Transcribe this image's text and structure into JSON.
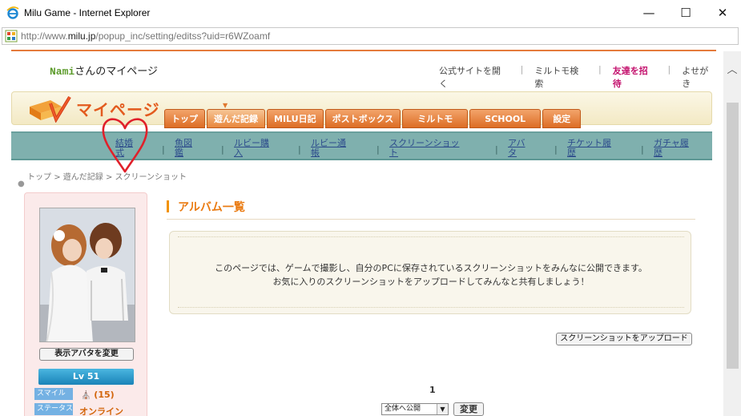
{
  "window": {
    "title": "Milu Game - Internet Explorer",
    "minimize": "—",
    "maximize": "☐",
    "close": "✕"
  },
  "address": {
    "prefix": "http://www.",
    "host": "milu.jp",
    "path": "/popup_inc/setting/editss?uid=r6WZoamf"
  },
  "header": {
    "user_name": "Nami",
    "user_suffix": "さんのマイページ",
    "links": [
      "公式サイトを開く",
      "ミルトモ検索",
      "友達を招待",
      "よせがき"
    ]
  },
  "banner": {
    "title": "マイページ",
    "tabs": [
      "トップ",
      "遊んだ記録",
      "MILU日記",
      "ポストボックス",
      "ミルトモ",
      "SCHOOL",
      "設定"
    ],
    "active_tab": "遊んだ記録"
  },
  "subnav": {
    "items": [
      {
        "line1": "結婚",
        "line2": "式"
      },
      {
        "line1": "魚図",
        "line2": "鑑"
      },
      {
        "line1": "ルビー購",
        "line2": "入"
      },
      {
        "line1": "ルビー通",
        "line2": "帳"
      },
      {
        "line1": "スクリーンショッ",
        "line2": "ト"
      },
      {
        "line1": "アバ",
        "line2": "タ"
      },
      {
        "line1": "チケット履",
        "line2": "歴"
      },
      {
        "line1": "ガチャ履",
        "line2": "歴"
      }
    ],
    "separator": "|",
    "highlight_color": "#e0202a"
  },
  "breadcrumb": {
    "items": [
      "トップ",
      "遊んだ記録",
      "スクリーンショット"
    ],
    "arrow": ">"
  },
  "profile": {
    "change_avatar": "表示アバタを変更",
    "level": "Lv 51",
    "smile_label": "スマイル",
    "smile_value": "(15)",
    "status_label": "ステータス",
    "status_value": "オンライン"
  },
  "main": {
    "section_title": "アルバム一覧",
    "notice_line1": "このページでは、ゲームで撮影し、自分のPCに保存されているスクリーンショットをみんなに公開できます。",
    "notice_line2": "お気に入りのスクリーンショットをアップロードしてみんなと共有しましょう！",
    "upload_button": "スクリーンショットをアップロード",
    "page_number": "1",
    "visibility_select": "全体へ公開",
    "change_button": "変更"
  }
}
